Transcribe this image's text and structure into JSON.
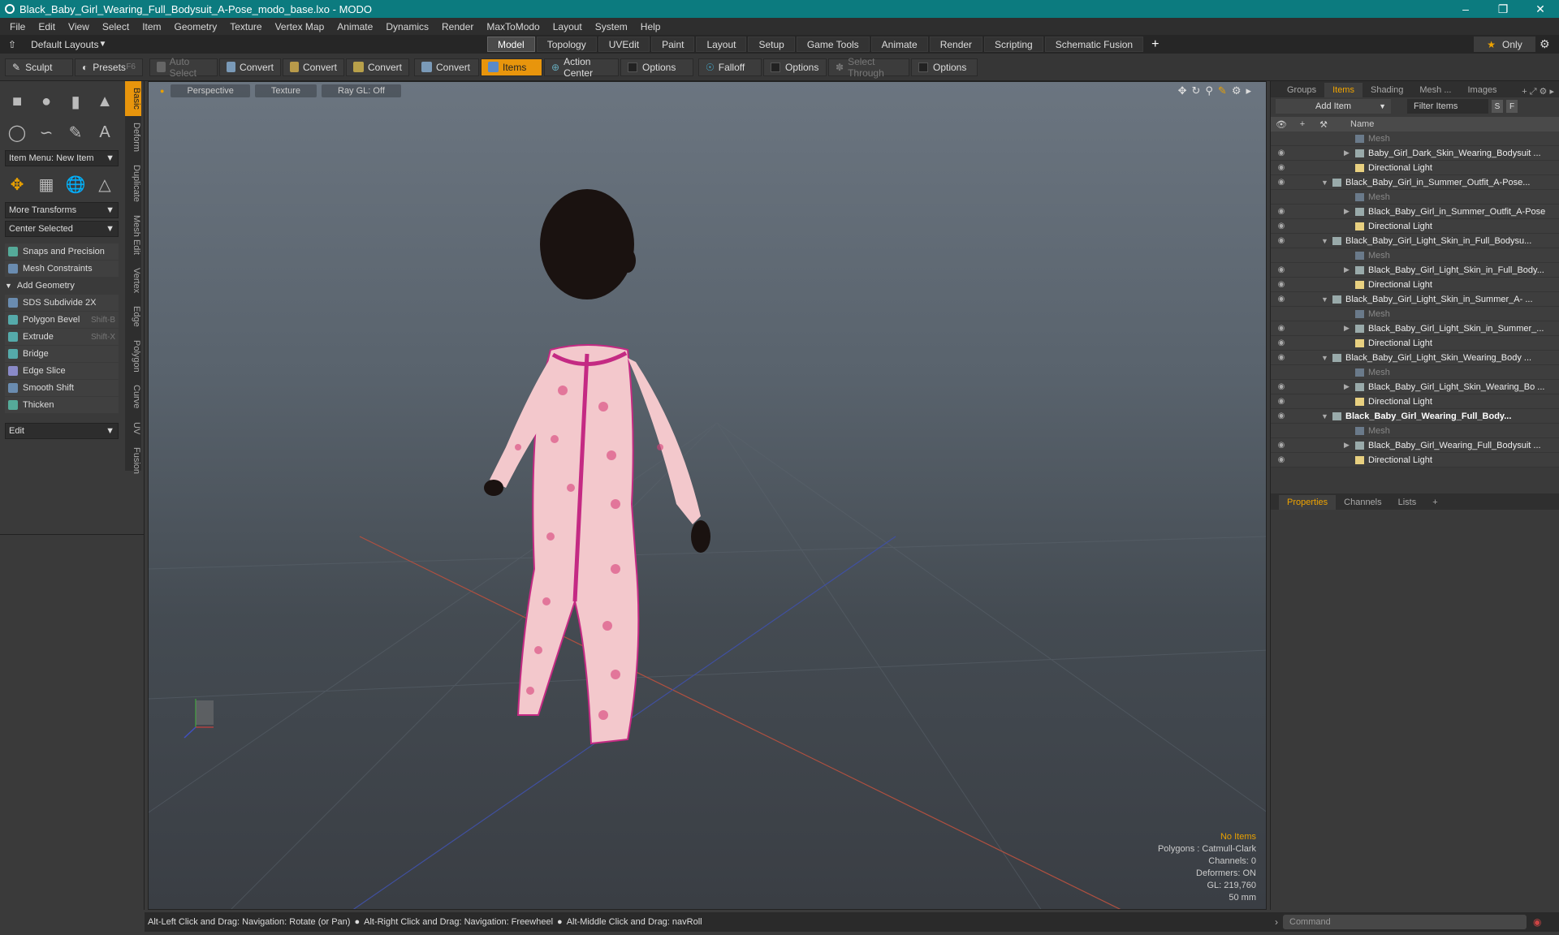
{
  "window": {
    "title": "Black_Baby_Girl_Wearing_Full_Bodysuit_A-Pose_modo_base.lxo - MODO"
  },
  "menu": [
    "File",
    "Edit",
    "View",
    "Select",
    "Item",
    "Geometry",
    "Texture",
    "Vertex Map",
    "Animate",
    "Dynamics",
    "Render",
    "MaxToModo",
    "Layout",
    "System",
    "Help"
  ],
  "layout": {
    "selector": "Default Layouts",
    "tabs": [
      "Model",
      "Topology",
      "UVEdit",
      "Paint",
      "Layout",
      "Setup",
      "Game Tools",
      "Animate",
      "Render",
      "Scripting",
      "Schematic Fusion"
    ],
    "active_tab": "Model",
    "only_label": "Only"
  },
  "toolbar": {
    "sculpt": "Sculpt",
    "presets": "Presets",
    "presets_shortcut": "F6",
    "auto_select": "Auto Select",
    "convert1": "Convert",
    "convert2": "Convert",
    "convert3": "Convert",
    "convert4": "Convert",
    "items": "Items",
    "action_center": "Action Center",
    "options1": "Options",
    "falloff": "Falloff",
    "options2": "Options",
    "select_through": "Select Through",
    "options3": "Options"
  },
  "left_panel": {
    "item_menu": "Item Menu: New Item",
    "more_transforms": "More Transforms",
    "center_selected": "Center Selected",
    "snaps": "Snaps and Precision",
    "mesh_constraints": "Mesh Constraints",
    "add_geometry": "Add Geometry",
    "tools": [
      {
        "label": "SDS Subdivide 2X",
        "shortcut": ""
      },
      {
        "label": "Polygon Bevel",
        "shortcut": "Shift-B"
      },
      {
        "label": "Extrude",
        "shortcut": "Shift-X"
      },
      {
        "label": "Bridge",
        "shortcut": ""
      },
      {
        "label": "Edge Slice",
        "shortcut": ""
      },
      {
        "label": "Smooth Shift",
        "shortcut": ""
      },
      {
        "label": "Thicken",
        "shortcut": ""
      }
    ],
    "edit": "Edit",
    "vtabs": [
      "Basic",
      "Deform",
      "Duplicate",
      "Mesh Edit",
      "Vertex",
      "Edge",
      "Polygon",
      "Curve",
      "UV",
      "Fusion"
    ]
  },
  "viewport": {
    "tabs": [
      "Perspective",
      "Texture",
      "Ray GL: Off"
    ],
    "info": {
      "no_items": "No Items",
      "polygons": "Polygons : Catmull-Clark",
      "channels": "Channels: 0",
      "deformers": "Deformers: ON",
      "gl": "GL: 219,760",
      "focal": "50 mm"
    }
  },
  "right_panel": {
    "tabs": [
      "Groups",
      "Items",
      "Shading",
      "Mesh ...",
      "Images"
    ],
    "add_item": "Add Item",
    "filter": "Filter Items",
    "s": "S",
    "f": "F",
    "col_name": "Name",
    "rows": [
      {
        "label": "Mesh",
        "type": "mesh",
        "indent": 2
      },
      {
        "label": "Baby_Girl_Dark_Skin_Wearing_Bodysuit ...",
        "type": "child",
        "indent": 2
      },
      {
        "label": "Directional Light",
        "type": "light",
        "indent": 2
      },
      {
        "label": "Black_Baby_Girl_in_Summer_Outfit_A-Pose...",
        "type": "scene",
        "indent": 1
      },
      {
        "label": "Mesh",
        "type": "mesh",
        "indent": 2
      },
      {
        "label": "Black_Baby_Girl_in_Summer_Outfit_A-Pose",
        "type": "child",
        "indent": 2
      },
      {
        "label": "Directional Light",
        "type": "light",
        "indent": 2
      },
      {
        "label": "Black_Baby_Girl_Light_Skin_in_Full_Bodysu...",
        "type": "scene",
        "indent": 1
      },
      {
        "label": "Mesh",
        "type": "mesh",
        "indent": 2
      },
      {
        "label": "Black_Baby_Girl_Light_Skin_in_Full_Body...",
        "type": "child",
        "indent": 2
      },
      {
        "label": "Directional Light",
        "type": "light",
        "indent": 2
      },
      {
        "label": "Black_Baby_Girl_Light_Skin_in_Summer_A- ...",
        "type": "scene",
        "indent": 1
      },
      {
        "label": "Mesh",
        "type": "mesh",
        "indent": 2
      },
      {
        "label": "Black_Baby_Girl_Light_Skin_in_Summer_...",
        "type": "child",
        "indent": 2
      },
      {
        "label": "Directional Light",
        "type": "light",
        "indent": 2
      },
      {
        "label": "Black_Baby_Girl_Light_Skin_Wearing_Body ...",
        "type": "scene",
        "indent": 1
      },
      {
        "label": "Mesh",
        "type": "mesh",
        "indent": 2
      },
      {
        "label": "Black_Baby_Girl_Light_Skin_Wearing_Bo ...",
        "type": "child",
        "indent": 2
      },
      {
        "label": "Directional Light",
        "type": "light",
        "indent": 2
      },
      {
        "label": "Black_Baby_Girl_Wearing_Full_Body...",
        "type": "scene-bold",
        "indent": 1
      },
      {
        "label": "Mesh",
        "type": "mesh",
        "indent": 2
      },
      {
        "label": "Black_Baby_Girl_Wearing_Full_Bodysuit ...",
        "type": "child",
        "indent": 2
      },
      {
        "label": "Directional Light",
        "type": "light",
        "indent": 2
      }
    ],
    "props_tabs": [
      "Properties",
      "Channels",
      "Lists"
    ]
  },
  "statusbar": {
    "hint1": "Alt-Left Click and Drag: Navigation: Rotate (or Pan)",
    "hint2": "Alt-Right Click and Drag: Navigation: Freewheel",
    "hint3": "Alt-Middle Click and Drag: navRoll"
  },
  "command": {
    "placeholder": "Command"
  },
  "colors": {
    "accent": "#e8950c",
    "titlebar": "#0c7b7f"
  }
}
